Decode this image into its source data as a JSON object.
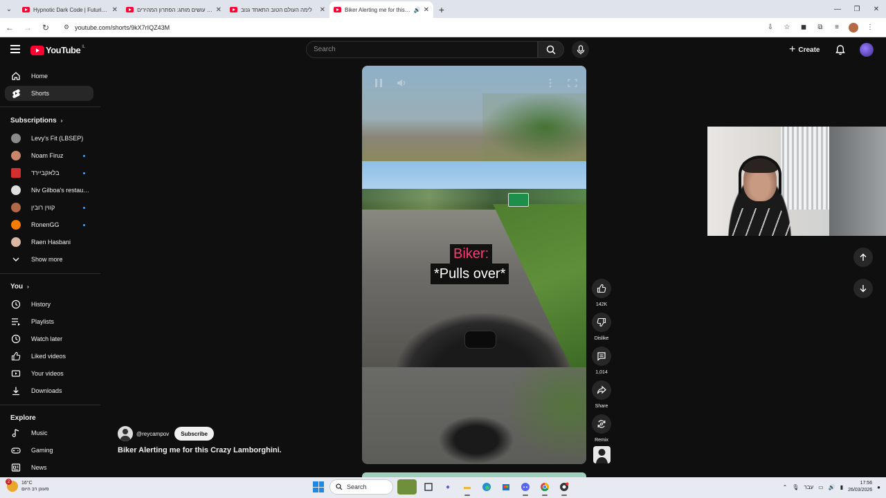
{
  "browser": {
    "tabs": [
      {
        "title": "Hypnotic Dark Code | Futuristic",
        "active": false,
        "audio": false
      },
      {
        "title": "עושים מותג: הפתרון המהירים …",
        "active": false,
        "audio": false
      },
      {
        "title": "לימה העולם הטוב התאחד גנוב",
        "active": false,
        "audio": false
      },
      {
        "title": "Biker Alerting me for this Cr…",
        "active": true,
        "audio": true
      }
    ],
    "url": "youtube.com/shorts/9kX7rIQZ43M"
  },
  "header": {
    "logo_text": "YouTube",
    "country_code": "IL",
    "search_placeholder": "Search",
    "create_label": "Create"
  },
  "sidebar": {
    "primary": [
      {
        "label": "Home",
        "icon": "home-icon"
      },
      {
        "label": "Shorts",
        "icon": "shorts-icon",
        "active": true
      }
    ],
    "subscriptions_heading": "Subscriptions",
    "subscriptions": [
      {
        "label": "Levy's Fit (LBSEP)",
        "color": "#8a8a8a",
        "new": false
      },
      {
        "label": "Noam Firuz",
        "color": "#c8876a",
        "new": true
      },
      {
        "label": "בלאקביירד",
        "color": "#d32f2f",
        "new": true
      },
      {
        "label": "Niv Gilboa's restaur…",
        "color": "#e0e0e0",
        "new": false
      },
      {
        "label": "קווין רובין",
        "color": "#b06a4a",
        "new": true
      },
      {
        "label": "RonenGG",
        "color": "#f57c00",
        "new": true
      },
      {
        "label": "Raen Hasbani",
        "color": "#d9b7a3",
        "new": false
      }
    ],
    "show_more": "Show more",
    "you_heading": "You",
    "you_items": [
      {
        "label": "History",
        "icon": "history-icon"
      },
      {
        "label": "Playlists",
        "icon": "playlists-icon"
      },
      {
        "label": "Watch later",
        "icon": "watch-later-icon"
      },
      {
        "label": "Liked videos",
        "icon": "liked-videos-icon"
      },
      {
        "label": "Your videos",
        "icon": "your-videos-icon"
      },
      {
        "label": "Downloads",
        "icon": "downloads-icon"
      }
    ],
    "explore_heading": "Explore",
    "explore_items": [
      {
        "label": "Music",
        "icon": "music-icon"
      },
      {
        "label": "Gaming",
        "icon": "gaming-icon"
      },
      {
        "label": "News",
        "icon": "news-icon"
      }
    ]
  },
  "short": {
    "caption_line1": "Biker:",
    "caption_line2": "*Pulls over*",
    "caption_colors": {
      "line1": "#ff3a72",
      "line2": "#ffffff"
    },
    "channel_handle": "@reycampov",
    "subscribe_label": "Subscribe",
    "title": "Biker Alerting me for this Crazy Lamborghini.",
    "actions": {
      "like_count": "142K",
      "dislike_label": "Dislike",
      "comment_count": "1,014",
      "share_label": "Share",
      "remix_label": "Remix"
    }
  },
  "taskbar": {
    "weather_temp": "16°C",
    "weather_desc": "מעונן רב היום",
    "weather_badge": "2",
    "search_label": "Search",
    "lang": "עבר",
    "time": "17:56",
    "date": "26/03/2026"
  }
}
